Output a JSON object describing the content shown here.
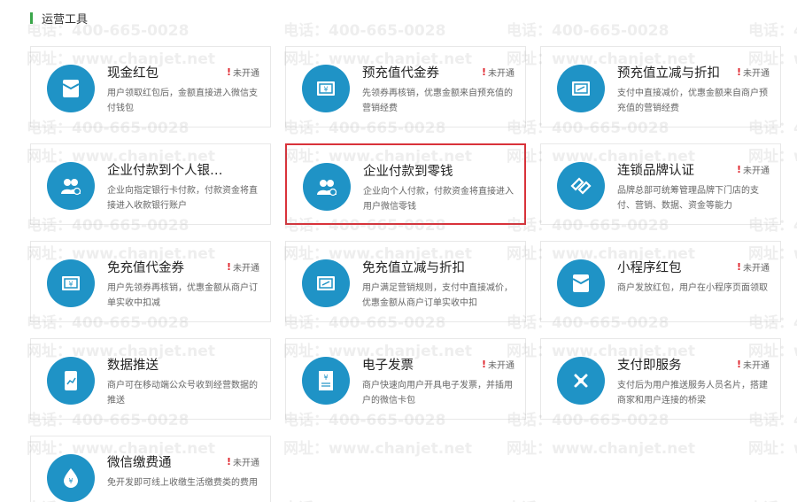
{
  "section": {
    "title": "运营工具",
    "accent": "#3aa64a"
  },
  "status_label": "未开通",
  "status_mark": "!",
  "icon_color": "#1f93c6",
  "highlight_color": "#d9323a",
  "watermark": {
    "phone": "电话：400-665-0028",
    "site": "网址：www.chanjet.net"
  },
  "cards": [
    {
      "title": "现金红包",
      "icon": "envelope-icon",
      "status": true,
      "desc": "用户领取红包后，金额直接进入微信支付钱包"
    },
    {
      "title": "预充值代金券",
      "icon": "coupon-icon",
      "status": true,
      "desc": "先领券再核销，优惠金额来自预充值的营销经费"
    },
    {
      "title": "预充值立减与折扣",
      "icon": "discount-icon",
      "status": true,
      "desc": "支付中直接减价，优惠金额来自商户预充值的营销经费"
    },
    {
      "title": "企业付款到个人银…",
      "icon": "users-icon",
      "status": false,
      "desc": "企业向指定银行卡付款，付款资金将直接进入收款银行账户"
    },
    {
      "title": "企业付款到零钱",
      "icon": "users-icon",
      "status": false,
      "desc": "企业向个人付款，付款资金将直接进入用户微信零钱"
    },
    {
      "title": "连锁品牌认证",
      "icon": "chain-icon",
      "status": true,
      "desc": "品牌总部可统筹管理品牌下门店的支付、营销、数据、资金等能力"
    },
    {
      "title": "免充值代金券",
      "icon": "coupon-icon",
      "status": true,
      "desc": "用户先领券再核销，优惠金额从商户订单实收中扣减"
    },
    {
      "title": "免充值立减与折扣",
      "icon": "discount-icon",
      "status": false,
      "desc": "用户满足营销规则，支付中直接减价，优惠金额从商户订单实收中扣"
    },
    {
      "title": "小程序红包",
      "icon": "envelope-icon",
      "status": true,
      "desc": "商户发放红包，用户在小程序页面领取"
    },
    {
      "title": "数据推送",
      "icon": "tablet-chart-icon",
      "status": false,
      "desc": "商户可在移动端公众号收到经营数据的推送"
    },
    {
      "title": "电子发票",
      "icon": "invoice-icon",
      "status": true,
      "desc": "商户快速向用户开具电子发票，并插用户的微信卡包"
    },
    {
      "title": "支付即服务",
      "icon": "link-icon",
      "status": true,
      "desc": "支付后为用户推送服务人员名片，搭建商家和用户连接的桥梁"
    },
    {
      "title": "微信缴费通",
      "icon": "water-drop-icon",
      "status": true,
      "desc": "免开发即可线上收缴生活缴费类的费用"
    }
  ]
}
